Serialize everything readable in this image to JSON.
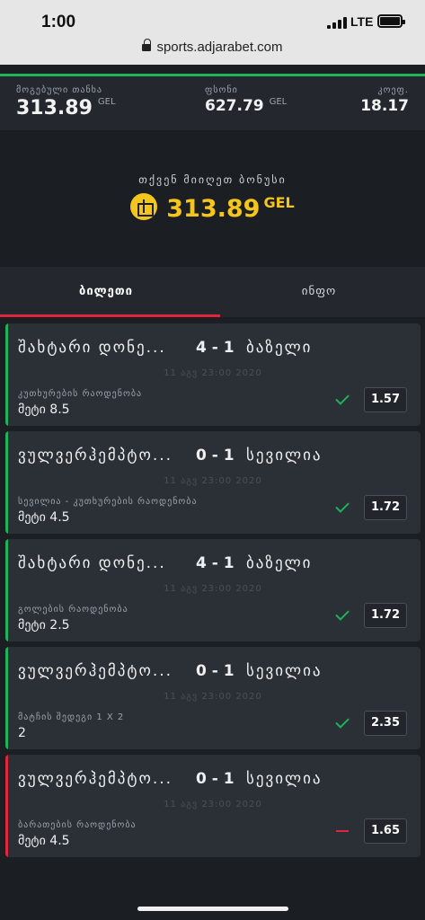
{
  "status_bar": {
    "time": "1:00",
    "network": "LTE",
    "url": "sports.adjarabet.com"
  },
  "summary": {
    "stake_label": "მოგებული თანხა",
    "stake_value": "313.89",
    "stake_unit": "GEL",
    "win_label": "ფსონი",
    "win_value": "627.79",
    "win_unit": "GEL",
    "odds_label": "კოეფ.",
    "odds_value": "18.17"
  },
  "bonus": {
    "label": "თქვენ მიიღეთ ბონუსი",
    "amount": "313.89",
    "unit": "GEL"
  },
  "tabs": {
    "bets": "ბილეთი",
    "info": "ინფო"
  },
  "bets": [
    {
      "home": "შახტარი დონე...",
      "score": "4 - 1",
      "away": "ბაზელი",
      "date": "11 აგვ 23:00 2020",
      "market": "კუთხურების რაოდენობა",
      "pick": "მეტი 8.5",
      "odd": "1.57",
      "status": "won"
    },
    {
      "home": "ვულვერჰემპტო...",
      "score": "0 - 1",
      "away": "სევილია",
      "date": "11 აგვ 23:00 2020",
      "market": "სევილია - კუთხურების რაოდენობა",
      "pick": "მეტი 4.5",
      "odd": "1.72",
      "status": "won"
    },
    {
      "home": "შახტარი დონე...",
      "score": "4 - 1",
      "away": "ბაზელი",
      "date": "11 აგვ 23:00 2020",
      "market": "გოლების რაოდენობა",
      "pick": "მეტი 2.5",
      "odd": "1.72",
      "status": "won"
    },
    {
      "home": "ვულვერჰემპტო...",
      "score": "0 - 1",
      "away": "სევილია",
      "date": "11 აგვ 23:00 2020",
      "market": "მატჩის შედეგი 1 X 2",
      "pick": "2",
      "odd": "2.35",
      "status": "won"
    },
    {
      "home": "ვულვერჰემპტო...",
      "score": "0 - 1",
      "away": "სევილია",
      "date": "11 აგვ 23:00 2020",
      "market": "ბარათების რაოდენობა",
      "pick": "მეტი 4.5",
      "odd": "1.65",
      "status": "lost"
    }
  ],
  "colors": {
    "accent_green": "#1fb35a",
    "accent_red": "#e0263f",
    "bonus_yellow": "#f4c51c",
    "card_bg": "#2b2f36"
  }
}
